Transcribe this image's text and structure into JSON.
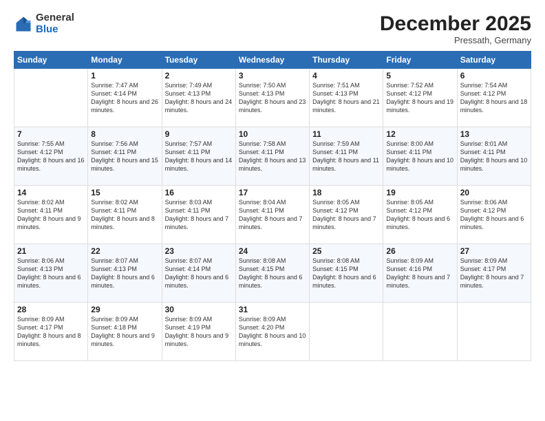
{
  "header": {
    "logo_general": "General",
    "logo_blue": "Blue",
    "month_title": "December 2025",
    "location": "Pressath, Germany"
  },
  "days_of_week": [
    "Sunday",
    "Monday",
    "Tuesday",
    "Wednesday",
    "Thursday",
    "Friday",
    "Saturday"
  ],
  "weeks": [
    [
      {
        "day": "",
        "sunrise": "",
        "sunset": "",
        "daylight": ""
      },
      {
        "day": "1",
        "sunrise": "Sunrise: 7:47 AM",
        "sunset": "Sunset: 4:14 PM",
        "daylight": "Daylight: 8 hours and 26 minutes."
      },
      {
        "day": "2",
        "sunrise": "Sunrise: 7:49 AM",
        "sunset": "Sunset: 4:13 PM",
        "daylight": "Daylight: 8 hours and 24 minutes."
      },
      {
        "day": "3",
        "sunrise": "Sunrise: 7:50 AM",
        "sunset": "Sunset: 4:13 PM",
        "daylight": "Daylight: 8 hours and 23 minutes."
      },
      {
        "day": "4",
        "sunrise": "Sunrise: 7:51 AM",
        "sunset": "Sunset: 4:13 PM",
        "daylight": "Daylight: 8 hours and 21 minutes."
      },
      {
        "day": "5",
        "sunrise": "Sunrise: 7:52 AM",
        "sunset": "Sunset: 4:12 PM",
        "daylight": "Daylight: 8 hours and 19 minutes."
      },
      {
        "day": "6",
        "sunrise": "Sunrise: 7:54 AM",
        "sunset": "Sunset: 4:12 PM",
        "daylight": "Daylight: 8 hours and 18 minutes."
      }
    ],
    [
      {
        "day": "7",
        "sunrise": "Sunrise: 7:55 AM",
        "sunset": "Sunset: 4:12 PM",
        "daylight": "Daylight: 8 hours and 16 minutes."
      },
      {
        "day": "8",
        "sunrise": "Sunrise: 7:56 AM",
        "sunset": "Sunset: 4:11 PM",
        "daylight": "Daylight: 8 hours and 15 minutes."
      },
      {
        "day": "9",
        "sunrise": "Sunrise: 7:57 AM",
        "sunset": "Sunset: 4:11 PM",
        "daylight": "Daylight: 8 hours and 14 minutes."
      },
      {
        "day": "10",
        "sunrise": "Sunrise: 7:58 AM",
        "sunset": "Sunset: 4:11 PM",
        "daylight": "Daylight: 8 hours and 13 minutes."
      },
      {
        "day": "11",
        "sunrise": "Sunrise: 7:59 AM",
        "sunset": "Sunset: 4:11 PM",
        "daylight": "Daylight: 8 hours and 11 minutes."
      },
      {
        "day": "12",
        "sunrise": "Sunrise: 8:00 AM",
        "sunset": "Sunset: 4:11 PM",
        "daylight": "Daylight: 8 hours and 10 minutes."
      },
      {
        "day": "13",
        "sunrise": "Sunrise: 8:01 AM",
        "sunset": "Sunset: 4:11 PM",
        "daylight": "Daylight: 8 hours and 10 minutes."
      }
    ],
    [
      {
        "day": "14",
        "sunrise": "Sunrise: 8:02 AM",
        "sunset": "Sunset: 4:11 PM",
        "daylight": "Daylight: 8 hours and 9 minutes."
      },
      {
        "day": "15",
        "sunrise": "Sunrise: 8:02 AM",
        "sunset": "Sunset: 4:11 PM",
        "daylight": "Daylight: 8 hours and 8 minutes."
      },
      {
        "day": "16",
        "sunrise": "Sunrise: 8:03 AM",
        "sunset": "Sunset: 4:11 PM",
        "daylight": "Daylight: 8 hours and 7 minutes."
      },
      {
        "day": "17",
        "sunrise": "Sunrise: 8:04 AM",
        "sunset": "Sunset: 4:11 PM",
        "daylight": "Daylight: 8 hours and 7 minutes."
      },
      {
        "day": "18",
        "sunrise": "Sunrise: 8:05 AM",
        "sunset": "Sunset: 4:12 PM",
        "daylight": "Daylight: 8 hours and 7 minutes."
      },
      {
        "day": "19",
        "sunrise": "Sunrise: 8:05 AM",
        "sunset": "Sunset: 4:12 PM",
        "daylight": "Daylight: 8 hours and 6 minutes."
      },
      {
        "day": "20",
        "sunrise": "Sunrise: 8:06 AM",
        "sunset": "Sunset: 4:12 PM",
        "daylight": "Daylight: 8 hours and 6 minutes."
      }
    ],
    [
      {
        "day": "21",
        "sunrise": "Sunrise: 8:06 AM",
        "sunset": "Sunset: 4:13 PM",
        "daylight": "Daylight: 8 hours and 6 minutes."
      },
      {
        "day": "22",
        "sunrise": "Sunrise: 8:07 AM",
        "sunset": "Sunset: 4:13 PM",
        "daylight": "Daylight: 8 hours and 6 minutes."
      },
      {
        "day": "23",
        "sunrise": "Sunrise: 8:07 AM",
        "sunset": "Sunset: 4:14 PM",
        "daylight": "Daylight: 8 hours and 6 minutes."
      },
      {
        "day": "24",
        "sunrise": "Sunrise: 8:08 AM",
        "sunset": "Sunset: 4:15 PM",
        "daylight": "Daylight: 8 hours and 6 minutes."
      },
      {
        "day": "25",
        "sunrise": "Sunrise: 8:08 AM",
        "sunset": "Sunset: 4:15 PM",
        "daylight": "Daylight: 8 hours and 6 minutes."
      },
      {
        "day": "26",
        "sunrise": "Sunrise: 8:09 AM",
        "sunset": "Sunset: 4:16 PM",
        "daylight": "Daylight: 8 hours and 7 minutes."
      },
      {
        "day": "27",
        "sunrise": "Sunrise: 8:09 AM",
        "sunset": "Sunset: 4:17 PM",
        "daylight": "Daylight: 8 hours and 7 minutes."
      }
    ],
    [
      {
        "day": "28",
        "sunrise": "Sunrise: 8:09 AM",
        "sunset": "Sunset: 4:17 PM",
        "daylight": "Daylight: 8 hours and 8 minutes."
      },
      {
        "day": "29",
        "sunrise": "Sunrise: 8:09 AM",
        "sunset": "Sunset: 4:18 PM",
        "daylight": "Daylight: 8 hours and 9 minutes."
      },
      {
        "day": "30",
        "sunrise": "Sunrise: 8:09 AM",
        "sunset": "Sunset: 4:19 PM",
        "daylight": "Daylight: 8 hours and 9 minutes."
      },
      {
        "day": "31",
        "sunrise": "Sunrise: 8:09 AM",
        "sunset": "Sunset: 4:20 PM",
        "daylight": "Daylight: 8 hours and 10 minutes."
      },
      {
        "day": "",
        "sunrise": "",
        "sunset": "",
        "daylight": ""
      },
      {
        "day": "",
        "sunrise": "",
        "sunset": "",
        "daylight": ""
      },
      {
        "day": "",
        "sunrise": "",
        "sunset": "",
        "daylight": ""
      }
    ]
  ]
}
